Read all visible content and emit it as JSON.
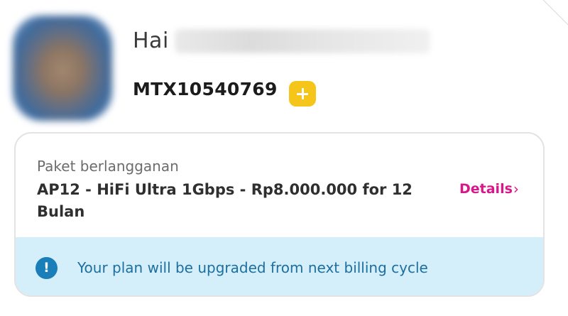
{
  "profile": {
    "greeting": "Hai",
    "account_id": "MTX10540769",
    "add_button_icon": "plus-icon",
    "add_button_color": "#f6c51a"
  },
  "subscription": {
    "label": "Paket berlangganan",
    "plan_name": "AP12 - HiFi Ultra 1Gbps - Rp8.000.000 for 12 Bulan",
    "details_label": "Details",
    "details_icon": "chevron-right-icon",
    "details_chevron": "›",
    "details_color": "#d8178a"
  },
  "notice": {
    "icon": "info-icon",
    "icon_glyph": "!",
    "text": "Your plan will be upgraded from next billing cycle",
    "background": "#d4eefa",
    "text_color": "#1d6f9f"
  }
}
